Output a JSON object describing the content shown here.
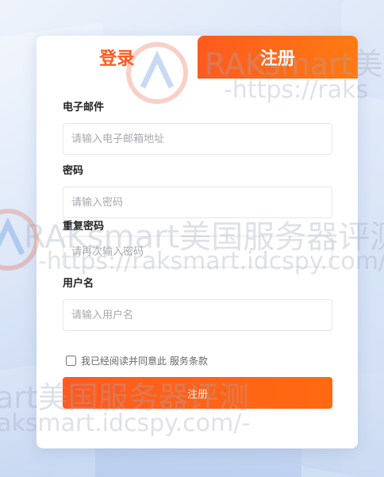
{
  "tabs": {
    "login": "登录",
    "register": "注册"
  },
  "form": {
    "email_label": "电子邮件",
    "email_placeholder": "请输入电子邮箱地址",
    "password_label": "密码",
    "password_placeholder": "请输入密码",
    "confirm_label": "重复密码",
    "confirm_placeholder": "请再次输入密码",
    "username_label": "用户名",
    "username_placeholder": "请输入用户名",
    "agree_text": "我已经阅读并同意此 服务条款",
    "submit_label": "注册"
  },
  "watermark": {
    "line1": "RAKsmart美国服务器评测",
    "line2": "-https://raksmart.idcspy.com/-",
    "fragment1": "RAKsmart美",
    "fragment2": "-https://raks",
    "fragment3": "art美国服务器评测",
    "fragment4": "aksmart.idcspy.com/-"
  },
  "colors": {
    "accent": "#ff5a1f",
    "accent_end": "#ff7a12"
  }
}
